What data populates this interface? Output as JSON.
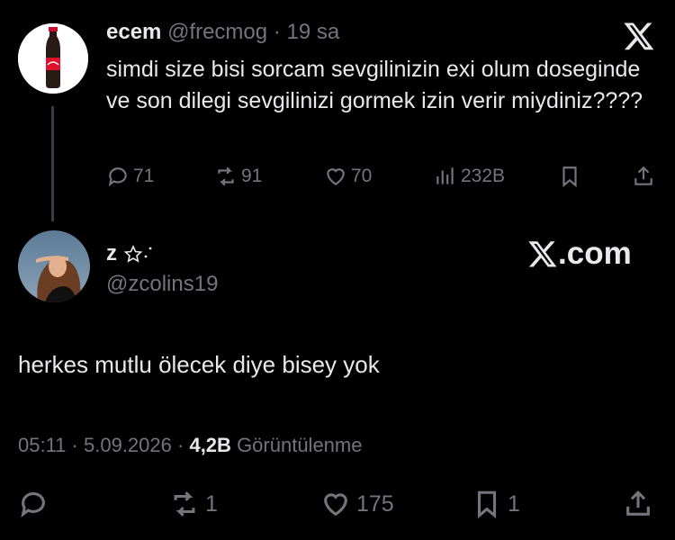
{
  "original_tweet": {
    "display_name": "ecem",
    "handle": "@frecmog",
    "separator": "·",
    "time": "19 sa",
    "text": "simdi size bisi sorcam sevgilinizin exi olum doseginde ve son dilegi sevgilinizi gormek izin verir miydiniz????",
    "stats": {
      "replies": "71",
      "reposts": "91",
      "likes": "70",
      "views": "232B"
    }
  },
  "reply": {
    "display_name": "z",
    "handle": "@zcolins19",
    "watermark": ".com",
    "text": "herkes mutlu ölecek diye bisey yok",
    "time": "05:11",
    "dot1": "·",
    "date": "5.09.2026",
    "dot2": "·",
    "views_count": "4,2B",
    "views_label": "Görüntülenme",
    "stats": {
      "reposts": "1",
      "likes": "175",
      "bookmarks": "1"
    }
  },
  "colors": {
    "background": "#000000",
    "text": "#e7e9ea",
    "muted": "#71767b",
    "line": "#3a3d41"
  },
  "icons": [
    "coke-bottle-avatar",
    "x-logo-icon",
    "reply-icon",
    "repost-icon",
    "like-icon",
    "views-icon",
    "bookmark-icon",
    "share-icon",
    "star-icon",
    "sparkle-icon"
  ]
}
